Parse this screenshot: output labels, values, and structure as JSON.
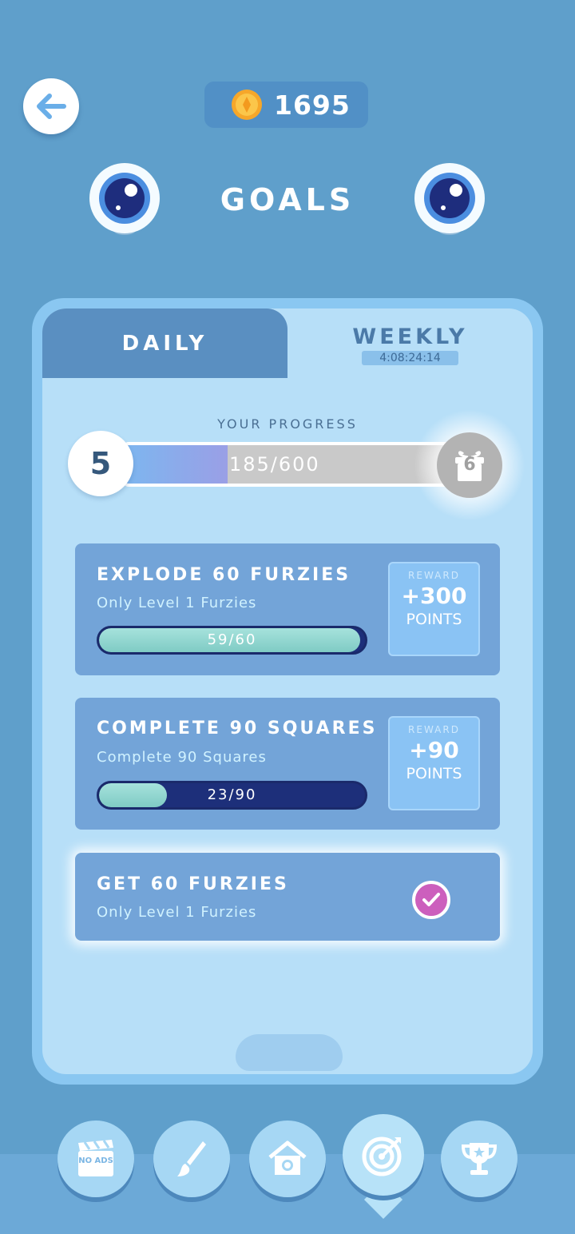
{
  "header": {
    "back_icon": "arrow-left-icon",
    "coins": "1695",
    "coin_icon": "gold-coin-icon",
    "title": "GOALS"
  },
  "tabs": {
    "daily": "DAILY",
    "weekly": "WEEKLY",
    "weekly_timer": "4:08:24:14",
    "active": "weekly"
  },
  "progress": {
    "label": "YOUR PROGRESS",
    "current_level": "5",
    "text": "185/600",
    "fraction": 0.308,
    "next_level": "6"
  },
  "goals": [
    {
      "title": "EXPLODE 60 FURZIES",
      "subtitle": "Only Level 1 Furzies",
      "progress_text": "59/60",
      "fraction": 0.983,
      "reward_label": "REWARD",
      "reward_value": "+300",
      "reward_unit": "POINTS"
    },
    {
      "title": "COMPLETE 90 SQUARES",
      "subtitle": "Complete 90 Squares",
      "progress_text": "23/90",
      "fraction": 0.256,
      "reward_label": "REWARD",
      "reward_value": "+90",
      "reward_unit": "POINTS"
    },
    {
      "title": "GET 60 FURZIES",
      "subtitle": "Only Level 1 Furzies",
      "completed": true
    }
  ],
  "nav": {
    "no_ads_label": "NO ADS",
    "items": [
      "no-ads-icon",
      "paintbrush-icon",
      "home-icon",
      "target-icon",
      "trophy-icon"
    ],
    "active": "target-icon"
  },
  "colors": {
    "background": "#5f9fcb",
    "panel": "#b7dff8",
    "card": "#73a4d8",
    "check": "#cc5fbd",
    "bar_dark": "#1d2f7a",
    "bar_fill": "#7fcbc4"
  }
}
